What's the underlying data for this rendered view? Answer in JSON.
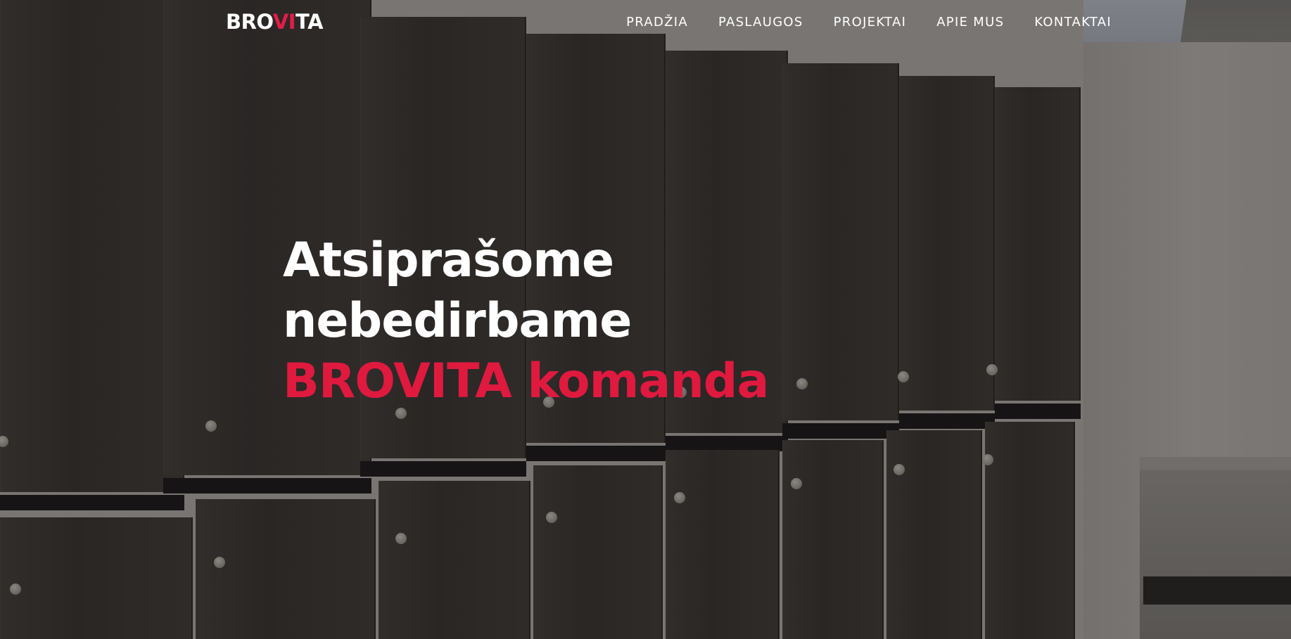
{
  "brand": {
    "logo_prefix": "BRO",
    "logo_accent": "VI",
    "logo_suffix": "TA",
    "accent_color": "#e0193f"
  },
  "nav": {
    "items": [
      {
        "label": "PRADŽIA"
      },
      {
        "label": "PASLAUGOS"
      },
      {
        "label": "PROJEKTAI"
      },
      {
        "label": "APIE MUS"
      },
      {
        "label": "KONTAKTAI"
      }
    ]
  },
  "hero": {
    "line1": "Atsiprašome",
    "line2": "nebedirbame",
    "line3": "BROVITA komanda"
  }
}
